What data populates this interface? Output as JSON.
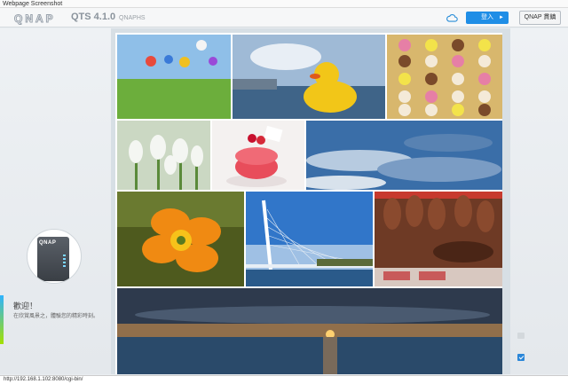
{
  "browser": {
    "title": "Webpage Screenshot",
    "status_url": "http://192.168.1.102:8080/cgi-bin/"
  },
  "header": {
    "logo_text": "QNAP",
    "version": "QTS 4.1.0",
    "nas_name": "QNAPHS",
    "login_label": "登入",
    "login_arrow": "►",
    "qnap_select_label": "QNAP 貫鎮"
  },
  "welcome": {
    "device_label": "QNAP",
    "title": "歡迎！",
    "message": "在欣賞風景之，體驗您的精彩時刻。"
  },
  "gallery": {
    "photos": [
      {
        "id": "hot-air-balloons",
        "colors": [
          "#8fbfe8",
          "#6cae3c"
        ]
      },
      {
        "id": "rubber-duck-harbor",
        "colors": [
          "#9fbad6",
          "#f2c618"
        ]
      },
      {
        "id": "macarons-box",
        "colors": [
          "#d8b76d",
          "#e67fa6"
        ]
      },
      {
        "id": "white-tulips",
        "colors": [
          "#cbd8c3",
          "#f4f6f2"
        ]
      },
      {
        "id": "strawberry-macaron",
        "colors": [
          "#f4f1f0",
          "#e84d5b"
        ]
      },
      {
        "id": "blue-sky-clouds",
        "colors": [
          "#3a6ea8",
          "#b7cbe0"
        ]
      },
      {
        "id": "orange-poppy",
        "colors": [
          "#4e5a1e",
          "#f08a12"
        ]
      },
      {
        "id": "cable-bridge",
        "colors": [
          "#3176c9",
          "#9fc0e4"
        ]
      },
      {
        "id": "ham-market",
        "colors": [
          "#6e3a25",
          "#c73a2e"
        ]
      },
      {
        "id": "ocean-sunset",
        "colors": [
          "#2e3a4d",
          "#f3a44a"
        ]
      }
    ]
  },
  "colors": {
    "accent_blue": "#1f8ee6",
    "accent_green": "#a4e000"
  },
  "icons": {
    "cloud": "cloud-icon",
    "rail_top": "message-icon",
    "rail_bottom": "check-icon"
  }
}
